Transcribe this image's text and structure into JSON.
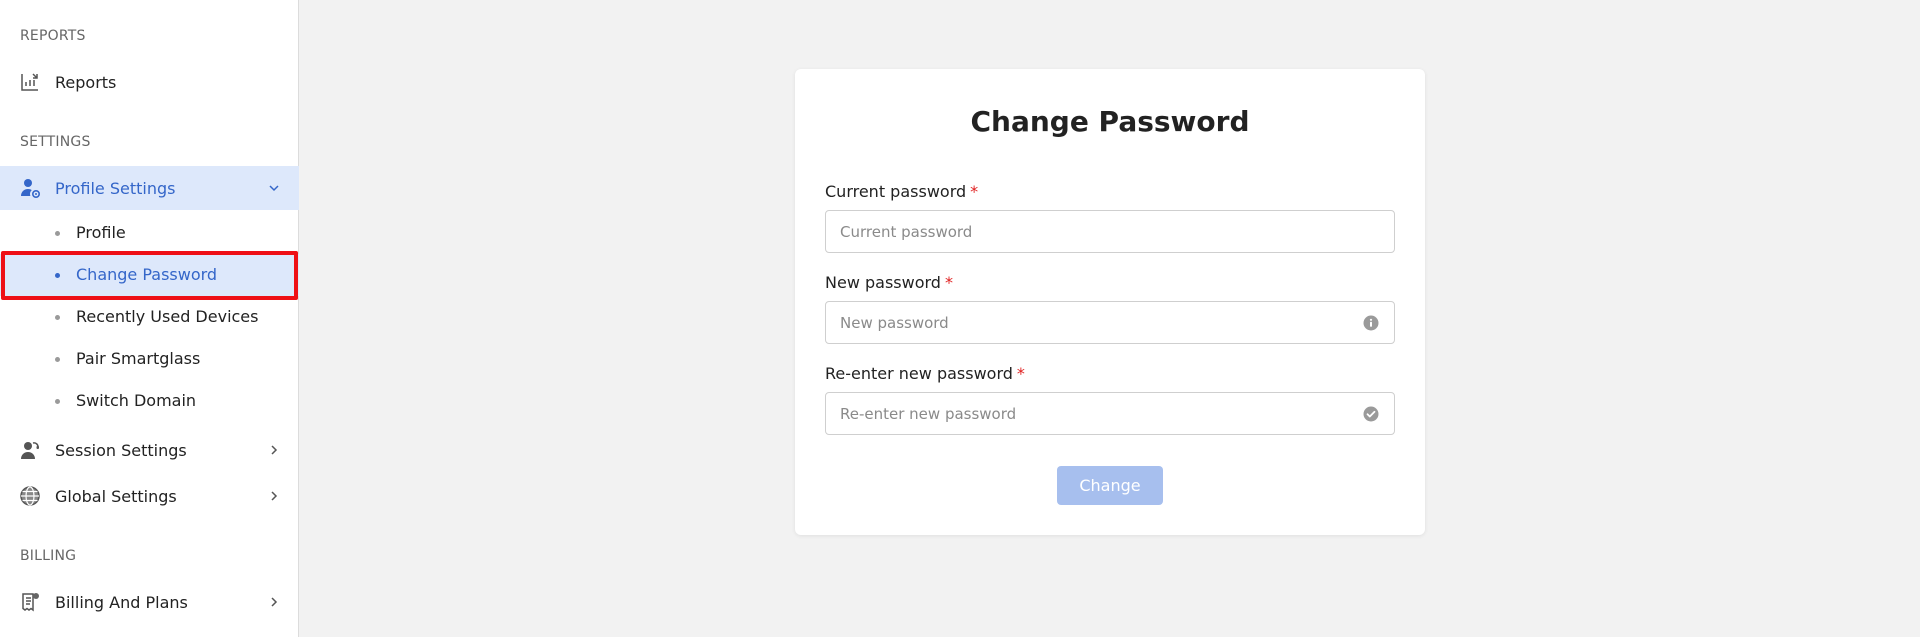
{
  "sidebar": {
    "sections": {
      "reports": "REPORTS",
      "settings": "SETTINGS",
      "billing": "BILLING"
    },
    "items": {
      "reports": "Reports",
      "profile_settings": "Profile Settings",
      "session_settings": "Session Settings",
      "global_settings": "Global Settings",
      "billing_and_plans": "Billing And Plans"
    },
    "sub_items": [
      "Profile",
      "Change Password",
      "Recently Used Devices",
      "Pair Smartglass",
      "Switch Domain"
    ],
    "active_item": "Profile Settings",
    "active_sub_item": "Change Password"
  },
  "form": {
    "title": "Change Password",
    "current_password": {
      "label": "Current password",
      "placeholder": "Current password",
      "value": "",
      "required_mark": "*"
    },
    "new_password": {
      "label": "New password",
      "placeholder": "New password",
      "value": "",
      "required_mark": "*",
      "suffix_icon": "info-icon"
    },
    "confirm_password": {
      "label": "Re-enter new password",
      "placeholder": "Re-enter new password",
      "value": "",
      "required_mark": "*",
      "suffix_icon": "check-circle-icon"
    },
    "submit_label": "Change"
  },
  "colors": {
    "accent": "#3466c9",
    "active_bg": "#dde8fb",
    "button_disabled": "#a7bfee",
    "required": "#e02020",
    "highlight": "#ee0f16"
  }
}
